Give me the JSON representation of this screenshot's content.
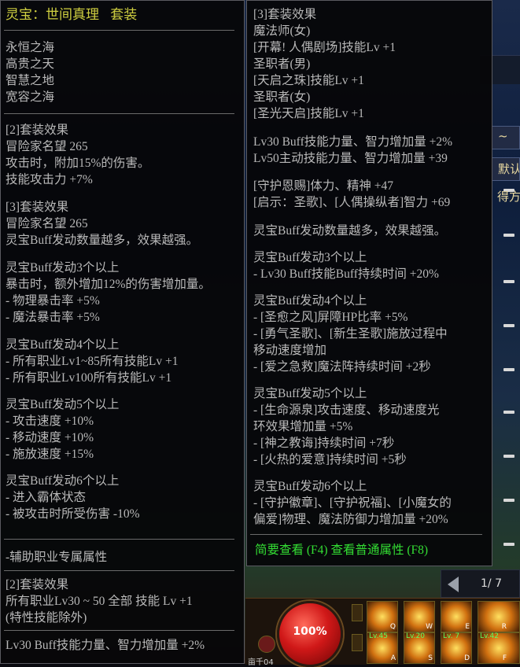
{
  "item": {
    "title_name": "灵宝：世间真理",
    "title_suffix": "套装",
    "parts": [
      "永恒之海",
      "高贵之天",
      "智慧之地",
      "宽容之海"
    ]
  },
  "left_sections": [
    {
      "lines": [
        "[2]套装效果",
        "冒险家名望 265",
        "攻击时，附加15%的伤害。",
        "技能攻击力 +7%"
      ]
    },
    {
      "lines": [
        "[3]套装效果",
        "冒险家名望 265",
        "灵宝Buff发动数量越多，效果越强。"
      ]
    },
    {
      "lines": [
        "灵宝Buff发动3个以上",
        "暴击时，额外增加12%的伤害增加量。",
        "- 物理暴击率 +5%",
        "- 魔法暴击率 +5%"
      ]
    },
    {
      "lines": [
        "灵宝Buff发动4个以上",
        "- 所有职业Lv1~85所有技能Lv +1",
        "- 所有职业Lv100所有技能Lv +1"
      ]
    },
    {
      "lines": [
        "灵宝Buff发动5个以上",
        "- 攻击速度 +10%",
        "- 移动速度 +10%",
        "- 施放速度 +15%"
      ]
    },
    {
      "lines": [
        "灵宝Buff发动6个以上",
        "- 进入霸体状态",
        "- 被攻击时所受伤害 -10%"
      ]
    }
  ],
  "support": {
    "header": "-辅助职业专属属性",
    "lines": [
      "[2]套装效果",
      "所有职业Lv30 ~ 50 全部 技能 Lv +1",
      "(特性技能除外)"
    ],
    "footer": "Lv30 Buff技能力量、智力增加量 +2%"
  },
  "right_sections": [
    {
      "lines": [
        "[3]套装效果",
        "魔法师(女)",
        "[开幕! 人偶剧场]技能Lv +1",
        "圣职者(男)",
        "[天启之珠]技能Lv +1",
        "圣职者(女)",
        "[圣光天启]技能Lv +1"
      ]
    },
    {
      "lines": [
        "Lv30 Buff技能力量、智力增加量 +2%",
        "Lv50主动技能力量、智力增加量 +39"
      ]
    },
    {
      "lines": [
        "[守护恩赐]体力、精神 +47",
        "[启示：圣歌]、[人偶操纵者]智力 +69"
      ]
    },
    {
      "lines": [
        "灵宝Buff发动数量越多，效果越强。"
      ]
    },
    {
      "lines": [
        "灵宝Buff发动3个以上",
        "- Lv30 Buff技能Buff持续时间 +20%"
      ]
    },
    {
      "lines": [
        "灵宝Buff发动4个以上",
        "- [圣愈之风]屏障HP比率 +5%",
        "- [勇气圣歌]、[新生圣歌]施放过程中",
        "移动速度增加",
        "- [爱之急救]魔法阵持续时间 +2秒"
      ]
    },
    {
      "lines": [
        "灵宝Buff发动5个以上",
        "- [生命源泉]攻击速度、移动速度光",
        "环效果增加量 +5%",
        "- [神之教诲]持续时间 +7秒",
        "- [火热的爱意]持续时间 +5秒"
      ]
    },
    {
      "lines": [
        "灵宝Buff发动6个以上",
        "- [守护徽章]、[守护祝福]、[小魔女的",
        "偏爱]物理、魔法防御力增加量 +20%"
      ]
    }
  ],
  "right_footer": "简要查看 (F4) 查看普通属性 (F8)",
  "game_ui": {
    "side_buttons": [
      "~",
      "默认",
      "得方"
    ],
    "page_indicator": "1/ 7",
    "hp_percent": "100%",
    "hud_label": "亩千04",
    "skills": [
      {
        "lv": "",
        "key": "Q"
      },
      {
        "lv": "",
        "key": "W"
      },
      {
        "lv": "",
        "key": "E"
      },
      {
        "lv": "",
        "key": "R"
      },
      {
        "lv": "Lv.45",
        "key": "A"
      },
      {
        "lv": "Lv.20",
        "key": "S"
      },
      {
        "lv": "Lv. 7",
        "key": "D"
      },
      {
        "lv": "Lv.42",
        "key": "F"
      }
    ],
    "colors": {
      "title": "#d0d040",
      "text": "#b9b9b9",
      "footer": "#33dd33",
      "hp_orb": "#d01818"
    }
  }
}
